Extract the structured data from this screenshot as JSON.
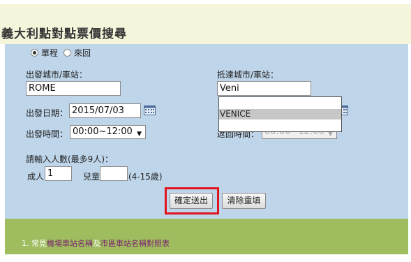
{
  "page": {
    "title": "義大利點對點票價搜尋"
  },
  "trip_type": {
    "one_way": "單程",
    "round_trip": "來回"
  },
  "departure": {
    "label": "出發城市/車站：",
    "value": "ROME"
  },
  "arrival": {
    "label": "抵達城市/車站：",
    "value": "Veni",
    "suggestion": "VENICE"
  },
  "depart_date": {
    "label": "出發日期：",
    "value": "2015/07/03"
  },
  "depart_time": {
    "label": "出發時間：",
    "value": "00:00~12:00"
  },
  "return_time": {
    "label": "返回時間：",
    "value": "00:00~12:00"
  },
  "passengers": {
    "label": "請輸入人數(最多9人)：",
    "adult_label": "成人",
    "adult_value": "1",
    "child_label": "兒童",
    "child_value": "",
    "child_note": "(4-15歲)"
  },
  "buttons": {
    "submit": "確定送出",
    "reset": "清除重填"
  },
  "footer": {
    "prefix": "1. 常見",
    "link1": "機場車站名稱",
    "middle": "及",
    "link2": "市區車站名稱對照表"
  },
  "colors": {
    "form_bg": "#bfd5ea",
    "footer_bg": "#9fbd5f",
    "highlight": "#e0141e",
    "title_bg": "#f5f5dc"
  }
}
